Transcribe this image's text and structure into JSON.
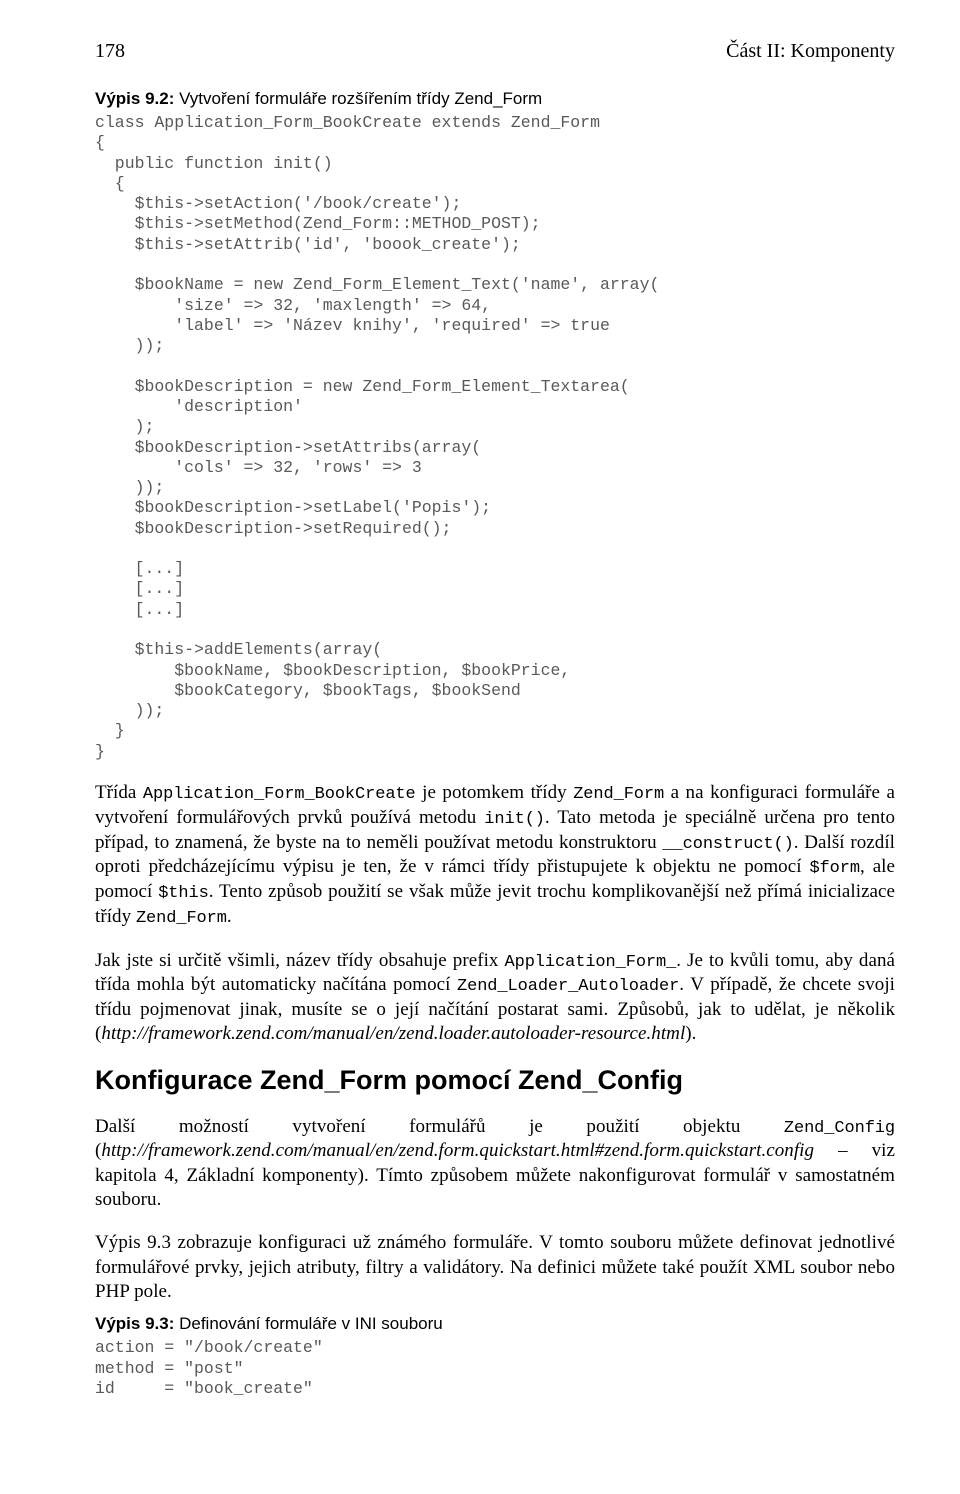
{
  "header": {
    "page_number": "178",
    "section": "Část II: Komponenty"
  },
  "listing92": {
    "label_bold": "Výpis 9.2:",
    "label_rest": " Vytvoření formuláře rozšířením třídy Zend_Form",
    "code": "class Application_Form_BookCreate extends Zend_Form\n{\n  public function init()\n  {\n    $this->setAction('/book/create');\n    $this->setMethod(Zend_Form::METHOD_POST);\n    $this->setAttrib('id', 'boook_create');\n\n    $bookName = new Zend_Form_Element_Text('name', array(\n        'size' => 32, 'maxlength' => 64,\n        'label' => 'Název knihy', 'required' => true\n    ));\n\n    $bookDescription = new Zend_Form_Element_Textarea(\n        'description'\n    );\n    $bookDescription->setAttribs(array(\n        'cols' => 32, 'rows' => 3\n    ));\n    $bookDescription->setLabel('Popis');\n    $bookDescription->setRequired();\n\n    [...]\n    [...]\n    [...]\n\n    $this->addElements(array(\n        $bookName, $bookDescription, $bookPrice,\n        $bookCategory, $bookTags, $bookSend\n    ));\n  }\n}"
  },
  "para1": {
    "t1": "Třída ",
    "m1": "Application_Form_BookCreate",
    "t2": " je potomkem třídy ",
    "m2": "Zend_Form",
    "t3": " a na konfiguraci formuláře a vytvoření formulářových prvků používá metodu ",
    "m3": "init()",
    "t4": ". Tato metoda je speciálně určena pro tento případ, to znamená, že byste na to neměli používat metodu konstruktoru ",
    "m4": "__construct()",
    "t5": ". Další rozdíl oproti předcházejícímu výpisu je ten, že v rámci třídy přistupujete k objektu ne pomocí ",
    "m5": "$form",
    "t6": ", ale pomocí ",
    "m6": "$this",
    "t7": ". Tento způsob použití se však může jevit trochu komplikovanější než přímá inicializace třídy ",
    "m7": "Zend_Form",
    "t8": "."
  },
  "para2": {
    "t1": "Jak jste si určitě všimli, název třídy obsahuje prefix ",
    "m1": "Application_Form_",
    "t2": ". Je to kvůli tomu, aby daná třída mohla být automaticky načítána pomocí ",
    "m2": "Zend_Loader_Autoloader",
    "t3": ". V případě, že chcete svoji třídu pojmenovat jinak, musíte se o její načítání postarat sami. Způsobů, jak to udělat, je několik (",
    "i1": "http://framework.zend.com/manual/en/zend.loader.autoloader-resource.html",
    "t4": ")."
  },
  "subhead": "Konfigurace Zend_Form pomocí Zend_Config",
  "para3": {
    "t1": "Další možností vytvoření formulářů je použití objektu ",
    "m1": "Zend_Config",
    "t2": " (",
    "i1": "http://framework.zend.com/manual/en/zend.form.quickstart.html#zend.form.quickstart.config",
    "t3": " – viz kapitola 4, Základní komponenty). Tímto způsobem můžete nakonfigurovat formulář v samostatném souboru."
  },
  "para4": "Výpis 9.3 zobrazuje konfiguraci už známého formuláře. V tomto souboru můžete definovat jednotlivé formulářové prvky, jejich atributy, filtry a validátory. Na definici můžete také použít XML soubor nebo PHP pole.",
  "listing93": {
    "label_bold": "Výpis 9.3:",
    "label_rest": " Definování formuláře v INI souboru",
    "code": "action = \"/book/create\"\nmethod = \"post\"\nid     = \"book_create\""
  }
}
